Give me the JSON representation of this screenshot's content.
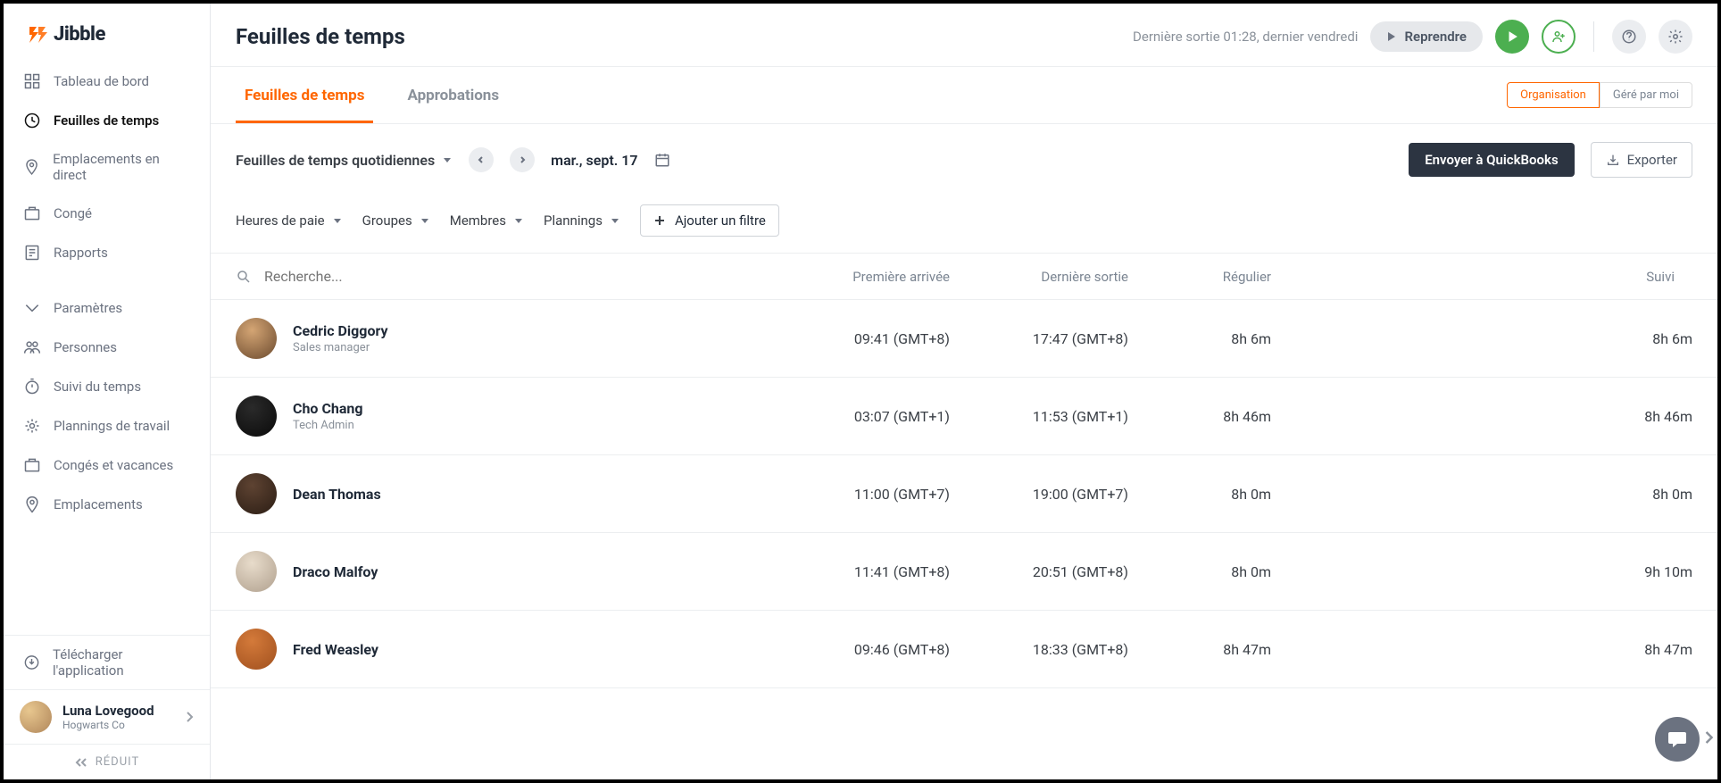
{
  "logo_text": "Jibble",
  "sidebar": {
    "items": [
      {
        "label": "Tableau de bord"
      },
      {
        "label": "Feuilles de temps"
      },
      {
        "label": "Emplacements en direct"
      },
      {
        "label": "Congé"
      },
      {
        "label": "Rapports"
      },
      {
        "label": "Paramètres"
      },
      {
        "label": "Personnes"
      },
      {
        "label": "Suivi du temps"
      },
      {
        "label": "Plannings de travail"
      },
      {
        "label": "Congés et vacances"
      },
      {
        "label": "Emplacements"
      }
    ],
    "download": "Télécharger l'application",
    "user_name": "Luna Lovegood",
    "user_org": "Hogwarts Co",
    "collapse": "RÉDUIT"
  },
  "header": {
    "title": "Feuilles de temps",
    "last_exit": "Dernière sortie 01:28, dernier vendredi",
    "resume": "Reprendre"
  },
  "tabs": {
    "timesheets": "Feuilles de temps",
    "approvals": "Approbations",
    "scope_org": "Organisation",
    "scope_me": "Géré par moi"
  },
  "controls": {
    "period": "Feuilles de temps quotidiennes",
    "date": "mar., sept. 17",
    "send_qb": "Envoyer à QuickBooks",
    "export": "Exporter"
  },
  "filters": {
    "pay": "Heures de paie",
    "groups": "Groupes",
    "members": "Membres",
    "schedules": "Plannings",
    "add": "Ajouter un filtre"
  },
  "table": {
    "search_placeholder": "Recherche...",
    "col_arrive": "Première arrivée",
    "col_exit": "Dernière sortie",
    "col_reg": "Régulier",
    "col_track": "Suivi",
    "rows": [
      {
        "name": "Cedric Diggory",
        "role": "Sales manager",
        "arrive": "09:41 (GMT+8)",
        "exit": "17:47 (GMT+8)",
        "reg": "8h 6m",
        "track": "8h 6m"
      },
      {
        "name": "Cho Chang",
        "role": "Tech Admin",
        "arrive": "03:07 (GMT+1)",
        "exit": "11:53 (GMT+1)",
        "reg": "8h 46m",
        "track": "8h 46m"
      },
      {
        "name": "Dean Thomas",
        "role": "",
        "arrive": "11:00 (GMT+7)",
        "exit": "19:00 (GMT+7)",
        "reg": "8h 0m",
        "track": "8h 0m"
      },
      {
        "name": "Draco Malfoy",
        "role": "",
        "arrive": "11:41 (GMT+8)",
        "exit": "20:51 (GMT+8)",
        "reg": "8h 0m",
        "track": "9h 10m"
      },
      {
        "name": "Fred Weasley",
        "role": "",
        "arrive": "09:46 (GMT+8)",
        "exit": "18:33 (GMT+8)",
        "reg": "8h 47m",
        "track": "8h 47m"
      }
    ]
  }
}
